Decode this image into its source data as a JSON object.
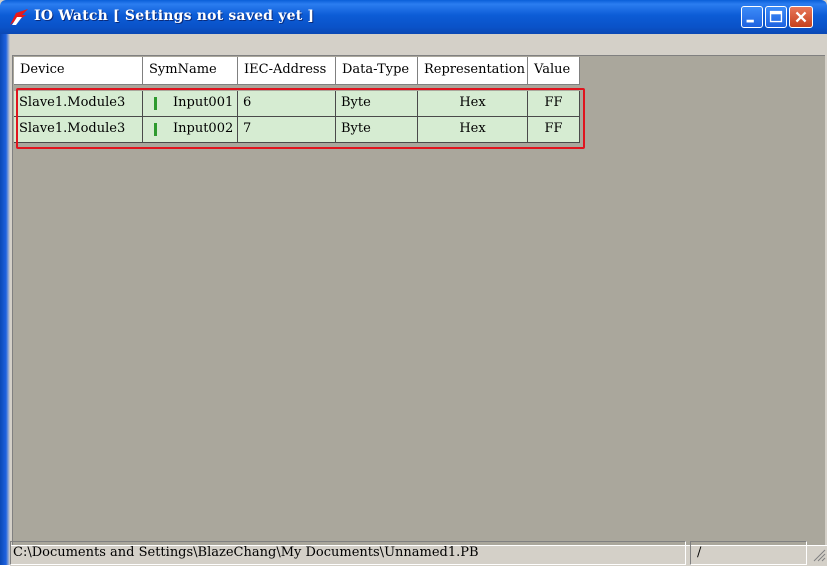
{
  "window": {
    "title": "IO Watch [ Settings not saved yet ]"
  },
  "table": {
    "columns": [
      "Device",
      "SymName",
      "IEC-Address",
      "Data-Type",
      "Representation",
      "Value"
    ],
    "rows": [
      {
        "device": "Slave1.Module3",
        "symname": "Input001",
        "iec_address": "6",
        "data_type": "Byte",
        "representation": "Hex",
        "value": "FF"
      },
      {
        "device": "Slave1.Module3",
        "symname": "Input002",
        "iec_address": "7",
        "data_type": "Byte",
        "representation": "Hex",
        "value": "FF"
      }
    ]
  },
  "statusbar": {
    "path": "C:\\Documents and Settings\\BlazeChang\\My Documents\\Unnamed1.PB",
    "pane2": "/"
  },
  "colors": {
    "titlebar": "#0a5cd6",
    "row_bg": "#d6ecd2",
    "highlight": "#e0141e",
    "list_bg": "#aaa79c",
    "status_marker": "#2e9a2e"
  }
}
